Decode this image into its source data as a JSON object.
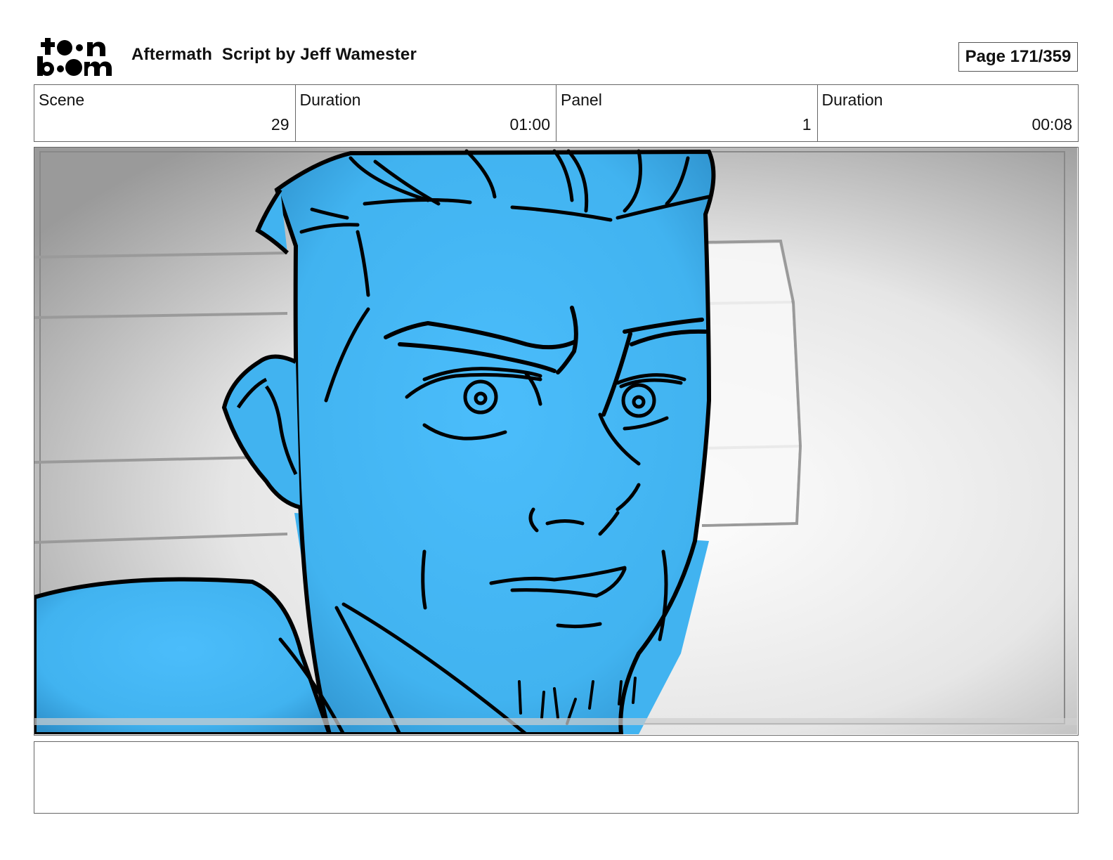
{
  "header": {
    "logo": {
      "text_top": "toon",
      "text_bottom": "boom",
      "icon": "toon-boom-logo"
    },
    "title": "Aftermath  Script by Jeff Wamester",
    "page": "Page 171/359"
  },
  "info": {
    "scene_label": "Scene",
    "scene_value": "29",
    "scene_duration_label": "Duration",
    "scene_duration_value": "01:00",
    "panel_label": "Panel",
    "panel_value": "1",
    "panel_duration_label": "Duration",
    "panel_duration_value": "00:08"
  },
  "panel": {
    "image": "storyboard-sketch-blue-man-face",
    "colors": {
      "skin": "#45b8f7",
      "line": "#000000",
      "background": "#d9d9d9"
    }
  },
  "notes": {
    "text": ""
  }
}
